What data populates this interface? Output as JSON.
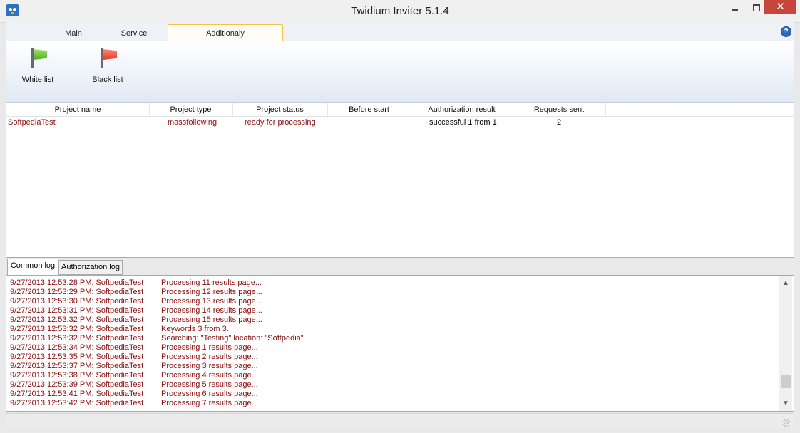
{
  "window": {
    "title": "Twidium Inviter 5.1.4"
  },
  "ribbon": {
    "tabs": [
      {
        "label": "Main"
      },
      {
        "label": "Service"
      },
      {
        "label": "Additionaly"
      }
    ],
    "active_tab": "Additionaly",
    "buttons": [
      {
        "label": "White list",
        "icon": "green-flag-icon"
      },
      {
        "label": "Black list",
        "icon": "red-flag-icon"
      }
    ]
  },
  "projects": {
    "columns": [
      "Project name",
      "Project type",
      "Project status",
      "Before start",
      "Authorization result",
      "Requests sent"
    ],
    "rows": [
      {
        "name": "SoftpediaTest",
        "type": "massfollowing",
        "status": "ready for processing",
        "before_start": "",
        "auth": "successful 1 from 1",
        "requests": "2"
      }
    ]
  },
  "log": {
    "tabs": [
      {
        "label": "Common log"
      },
      {
        "label": "Authorization log"
      }
    ],
    "active_tab": "Common log",
    "lines": [
      {
        "ts": "9/27/2013 12:53:28 PM: SoftpediaTest",
        "msg": "Processing 11 results page..."
      },
      {
        "ts": "9/27/2013 12:53:29 PM: SoftpediaTest",
        "msg": "Processing 12 results page..."
      },
      {
        "ts": "9/27/2013 12:53:30 PM: SoftpediaTest",
        "msg": "Processing 13 results page..."
      },
      {
        "ts": "9/27/2013 12:53:31 PM: SoftpediaTest",
        "msg": "Processing 14 results page..."
      },
      {
        "ts": "9/27/2013 12:53:32 PM: SoftpediaTest",
        "msg": "Processing 15 results page..."
      },
      {
        "ts": "9/27/2013 12:53:32 PM: SoftpediaTest",
        "msg": "Keywords 3 from 3."
      },
      {
        "ts": "9/27/2013 12:53:32 PM: SoftpediaTest",
        "msg": "Searching: \"Testing\" location: \"Softpedia\""
      },
      {
        "ts": "9/27/2013 12:53:34 PM: SoftpediaTest",
        "msg": "Processing 1 results page..."
      },
      {
        "ts": "9/27/2013 12:53:35 PM: SoftpediaTest",
        "msg": "Processing 2 results page..."
      },
      {
        "ts": "9/27/2013 12:53:37 PM: SoftpediaTest",
        "msg": "Processing 3 results page..."
      },
      {
        "ts": "9/27/2013 12:53:38 PM: SoftpediaTest",
        "msg": "Processing 4 results page..."
      },
      {
        "ts": "9/27/2013 12:53:39 PM: SoftpediaTest",
        "msg": "Processing 5 results page..."
      },
      {
        "ts": "9/27/2013 12:53:41 PM: SoftpediaTest",
        "msg": "Processing 6 results page..."
      },
      {
        "ts": "9/27/2013 12:53:42 PM: SoftpediaTest",
        "msg": "Processing 7 results page..."
      }
    ]
  },
  "colors": {
    "log_text": "#8b0d0d",
    "close_button": "#c7463b",
    "tab_border": "#f3c24e"
  }
}
